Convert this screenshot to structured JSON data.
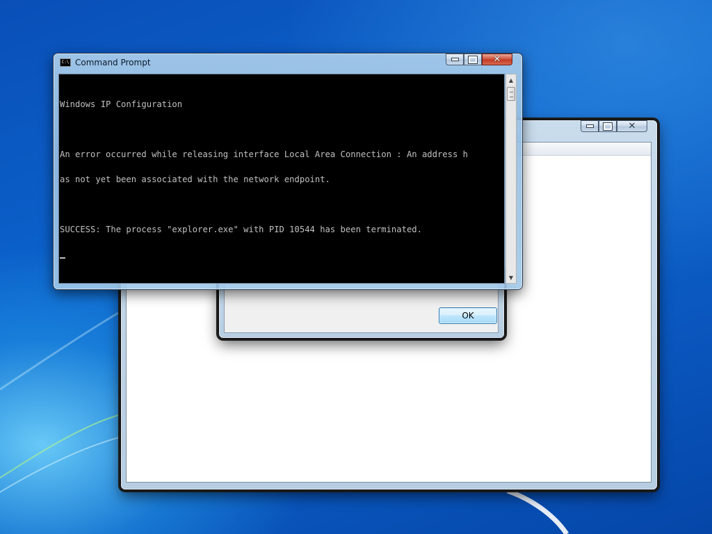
{
  "desktop": {
    "theme": "windows-7-aero",
    "accent": "#0b63cc"
  },
  "command_prompt": {
    "title": "Command Prompt",
    "icon": "cmd-icon",
    "icon_text": "C:\\",
    "lines": [
      "Windows IP Configuration",
      "",
      "An error occurred while releasing interface Local Area Connection : An address h",
      "as not yet been associated with the network endpoint.",
      "",
      "SUCCESS: The process \"explorer.exe\" with PID 10544 has been terminated."
    ]
  },
  "dialog": {
    "ok_label": "OK"
  }
}
